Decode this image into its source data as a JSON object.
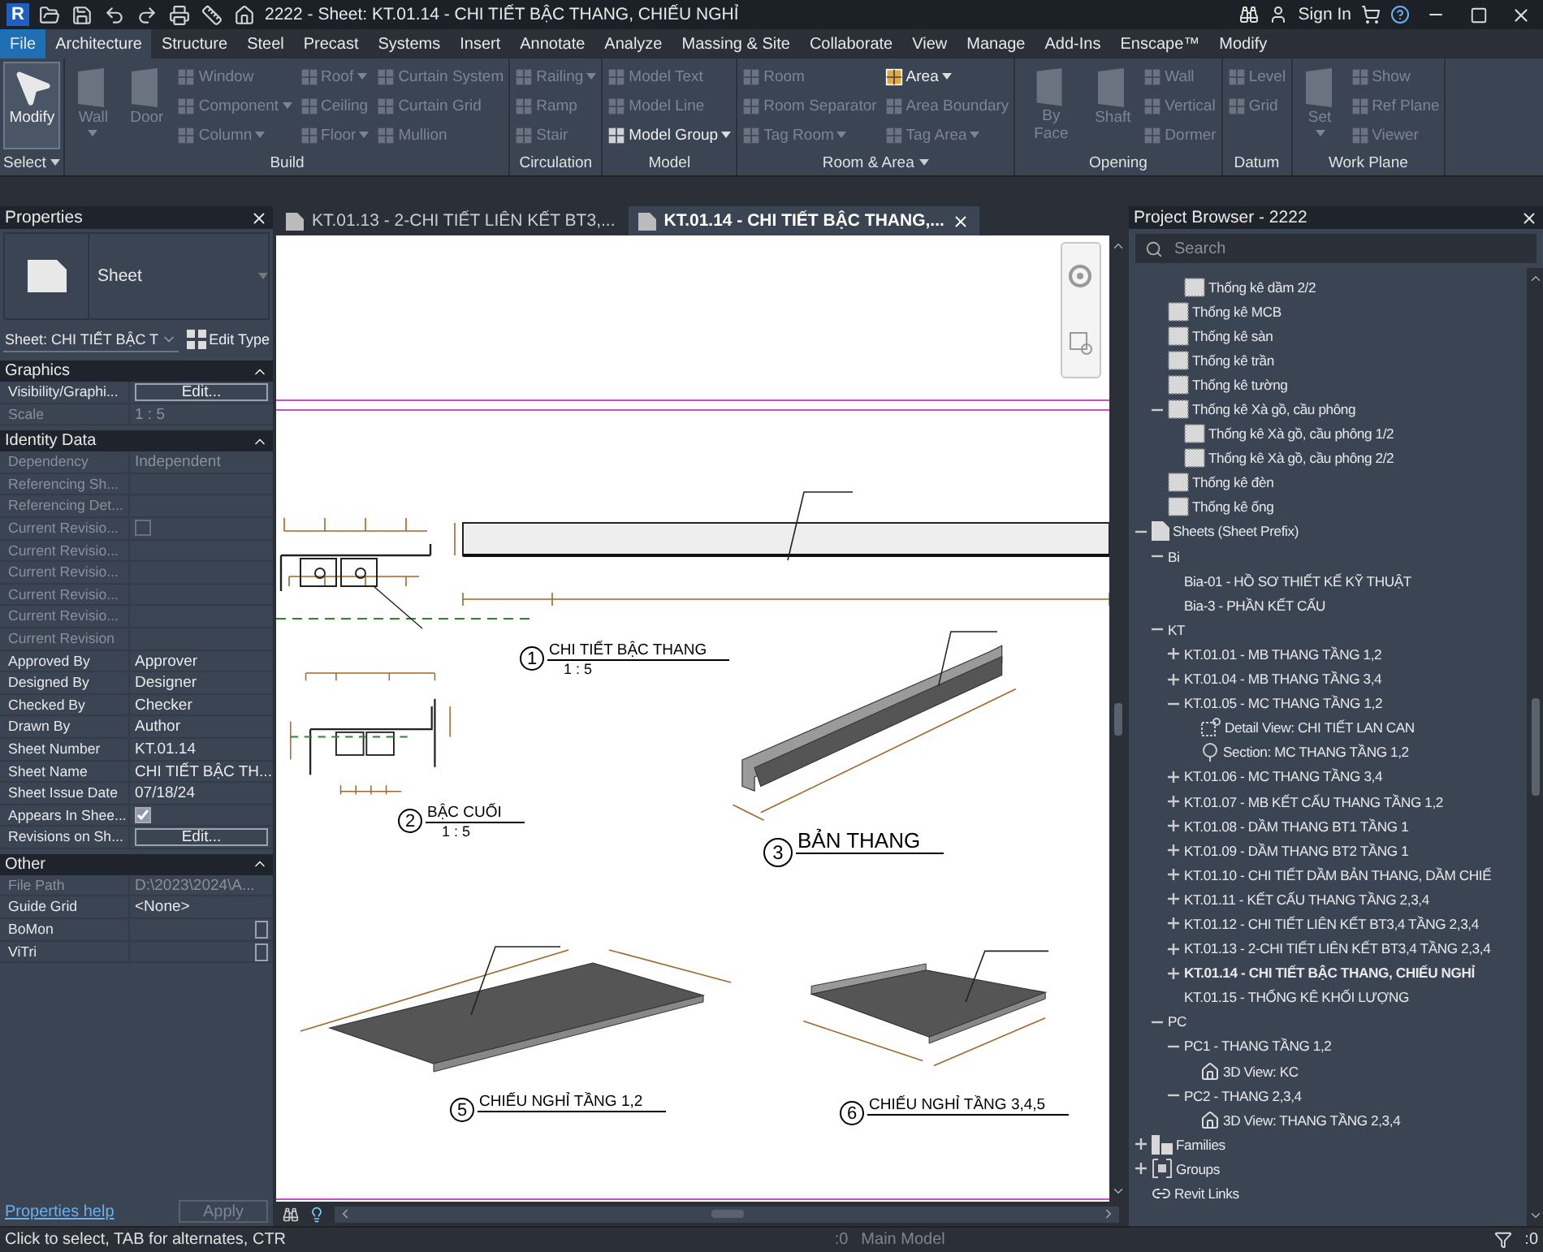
{
  "title_bar": {
    "app_logo": "R",
    "title": "2222 - Sheet: KT.01.14 - CHI TIẾT BẬC THANG, CHIẾU NGHỈ",
    "sign_in": "Sign In"
  },
  "ribbon_tabs": [
    {
      "label": "File",
      "kind": "file",
      "selected": false
    },
    {
      "label": "Architecture",
      "kind": "tab",
      "selected": true
    },
    {
      "label": "Structure",
      "kind": "tab",
      "selected": false
    },
    {
      "label": "Steel",
      "kind": "tab",
      "selected": false
    },
    {
      "label": "Precast",
      "kind": "tab",
      "selected": false
    },
    {
      "label": "Systems",
      "kind": "tab",
      "selected": false
    },
    {
      "label": "Insert",
      "kind": "tab",
      "selected": false
    },
    {
      "label": "Annotate",
      "kind": "tab",
      "selected": false
    },
    {
      "label": "Analyze",
      "kind": "tab",
      "selected": false
    },
    {
      "label": "Massing & Site",
      "kind": "tab",
      "selected": false
    },
    {
      "label": "Collaborate",
      "kind": "tab",
      "selected": false
    },
    {
      "label": "View",
      "kind": "tab",
      "selected": false
    },
    {
      "label": "Manage",
      "kind": "tab",
      "selected": false
    },
    {
      "label": "Add-Ins",
      "kind": "tab",
      "selected": false
    },
    {
      "label": "Enscape™",
      "kind": "tab",
      "selected": false
    },
    {
      "label": "Modify",
      "kind": "tab",
      "selected": false
    }
  ],
  "ribbon_groups": [
    {
      "label": "Select",
      "menu": true,
      "items": [
        {
          "kind": "big",
          "label": "Modify",
          "disabled": false,
          "dropdown": false,
          "active": true
        }
      ]
    },
    {
      "label": "Build",
      "menu": false,
      "items": [
        {
          "kind": "big",
          "label": "Wall",
          "disabled": true,
          "dropdown": true,
          "active": false
        },
        {
          "kind": "big",
          "label": "Door",
          "disabled": true,
          "dropdown": false,
          "active": false
        },
        {
          "kind": "small",
          "label": "Window",
          "disabled": true,
          "dropdown": false,
          "active": false
        },
        {
          "kind": "small",
          "label": "Component",
          "disabled": true,
          "dropdown": true,
          "active": false
        },
        {
          "kind": "small",
          "label": "Column",
          "disabled": true,
          "dropdown": true,
          "active": false
        },
        {
          "kind": "small",
          "label": "Roof",
          "disabled": true,
          "dropdown": true,
          "active": false
        },
        {
          "kind": "small",
          "label": "Ceiling",
          "disabled": true,
          "dropdown": false,
          "active": false
        },
        {
          "kind": "small",
          "label": "Floor",
          "disabled": true,
          "dropdown": true,
          "active": false
        },
        {
          "kind": "small",
          "label": "Curtain System",
          "disabled": true,
          "dropdown": false,
          "active": false
        },
        {
          "kind": "small",
          "label": "Curtain Grid",
          "disabled": true,
          "dropdown": false,
          "active": false
        },
        {
          "kind": "small",
          "label": "Mullion",
          "disabled": true,
          "dropdown": false,
          "active": false
        }
      ]
    },
    {
      "label": "Circulation",
      "menu": false,
      "items": [
        {
          "kind": "small",
          "label": "Railing",
          "disabled": true,
          "dropdown": true,
          "active": false
        },
        {
          "kind": "small",
          "label": "Ramp",
          "disabled": true,
          "dropdown": false,
          "active": false
        },
        {
          "kind": "small",
          "label": "Stair",
          "disabled": true,
          "dropdown": false,
          "active": false
        }
      ]
    },
    {
      "label": "Model",
      "menu": false,
      "items": [
        {
          "kind": "small",
          "label": "Model Text",
          "disabled": true,
          "dropdown": false,
          "active": false
        },
        {
          "kind": "small",
          "label": "Model Line",
          "disabled": true,
          "dropdown": false,
          "active": false
        },
        {
          "kind": "small",
          "label": "Model Group",
          "disabled": false,
          "dropdown": true,
          "active": false
        }
      ]
    },
    {
      "label": "Room & Area",
      "menu": true,
      "items": [
        {
          "kind": "small",
          "label": "Room",
          "disabled": true,
          "dropdown": false,
          "active": false
        },
        {
          "kind": "small",
          "label": "Room Separator",
          "disabled": true,
          "dropdown": false,
          "active": false
        },
        {
          "kind": "small",
          "label": "Tag Room",
          "disabled": true,
          "dropdown": true,
          "active": false
        },
        {
          "kind": "small",
          "label": "Area",
          "disabled": false,
          "dropdown": true,
          "active": false
        },
        {
          "kind": "small",
          "label": "Area Boundary",
          "disabled": true,
          "dropdown": false,
          "active": false
        },
        {
          "kind": "small",
          "label": "Tag Area",
          "disabled": true,
          "dropdown": true,
          "active": false
        }
      ]
    },
    {
      "label": "Opening",
      "menu": false,
      "items": [
        {
          "kind": "big",
          "label": "By Face",
          "disabled": true,
          "dropdown": false,
          "active": false
        },
        {
          "kind": "big",
          "label": "Shaft",
          "disabled": true,
          "dropdown": false,
          "active": false
        },
        {
          "kind": "small",
          "label": "Wall",
          "disabled": true,
          "dropdown": false,
          "active": false
        },
        {
          "kind": "small",
          "label": "Vertical",
          "disabled": true,
          "dropdown": false,
          "active": false
        },
        {
          "kind": "small",
          "label": "Dormer",
          "disabled": true,
          "dropdown": false,
          "active": false
        }
      ]
    },
    {
      "label": "Datum",
      "menu": false,
      "items": [
        {
          "kind": "mid",
          "label": "Level",
          "disabled": true,
          "dropdown": false,
          "active": false
        },
        {
          "kind": "mid",
          "label": "Grid",
          "disabled": true,
          "dropdown": false,
          "active": false
        }
      ]
    },
    {
      "label": "Work Plane",
      "menu": false,
      "items": [
        {
          "kind": "big",
          "label": "Set",
          "disabled": true,
          "dropdown": true,
          "active": false
        },
        {
          "kind": "small",
          "label": "Show",
          "disabled": true,
          "dropdown": false,
          "active": false
        },
        {
          "kind": "small",
          "label": "Ref Plane",
          "disabled": true,
          "dropdown": false,
          "active": false
        },
        {
          "kind": "small",
          "label": "Viewer",
          "disabled": true,
          "dropdown": false,
          "active": false
        }
      ]
    }
  ],
  "properties": {
    "title": "Properties",
    "type_name": "Sheet",
    "instance": "Sheet: CHI TIẾT BẬC T",
    "edit_type": "Edit Type",
    "sections": [
      {
        "title": "Graphics",
        "rows": [
          {
            "label": "Visibility/Graphi...",
            "kind": "button",
            "value": "Edit...",
            "disabled": false
          },
          {
            "label": "Scale",
            "kind": "text",
            "value": "1 : 5",
            "disabled": true
          }
        ]
      },
      {
        "title": "Identity Data",
        "rows": [
          {
            "label": "Dependency",
            "kind": "text",
            "value": "Independent",
            "disabled": true
          },
          {
            "label": "Referencing Sh...",
            "kind": "text",
            "disabled": true
          },
          {
            "label": "Referencing Det...",
            "kind": "text",
            "disabled": true
          },
          {
            "label": "Current Revisio...",
            "kind": "checkbox",
            "checked": false,
            "disabled": true
          },
          {
            "label": "Current Revisio...",
            "kind": "text",
            "disabled": true
          },
          {
            "label": "Current Revisio...",
            "kind": "text",
            "disabled": true
          },
          {
            "label": "Current Revisio...",
            "kind": "text",
            "disabled": true
          },
          {
            "label": "Current Revisio...",
            "kind": "text",
            "disabled": true
          },
          {
            "label": "Current Revision",
            "kind": "text",
            "disabled": true
          },
          {
            "label": "Approved By",
            "kind": "text",
            "value": "Approver",
            "disabled": false
          },
          {
            "label": "Designed By",
            "kind": "text",
            "value": "Designer",
            "disabled": false
          },
          {
            "label": "Checked By",
            "kind": "text",
            "value": "Checker",
            "disabled": false
          },
          {
            "label": "Drawn By",
            "kind": "text",
            "value": "Author",
            "disabled": false
          },
          {
            "label": "Sheet Number",
            "kind": "text",
            "value": "KT.01.14",
            "disabled": false
          },
          {
            "label": "Sheet Name",
            "kind": "text",
            "value": "CHI TIẾT BẬC TH...",
            "disabled": false
          },
          {
            "label": "Sheet Issue Date",
            "kind": "text",
            "value": "07/18/24",
            "disabled": false
          },
          {
            "label": "Appears In Shee...",
            "kind": "checkbox",
            "checked": true,
            "disabled": false
          },
          {
            "label": "Revisions on Sh...",
            "kind": "button",
            "value": "Edit...",
            "disabled": false
          }
        ]
      },
      {
        "title": "Other",
        "rows": [
          {
            "label": "File Path",
            "kind": "text",
            "value": "D:\\2023\\2024\\A...",
            "disabled": true
          },
          {
            "label": "Guide Grid",
            "kind": "text",
            "value": "<None>",
            "disabled": false
          },
          {
            "label": "BoMon",
            "kind": "picker",
            "disabled": false
          },
          {
            "label": "ViTri",
            "kind": "picker",
            "disabled": false
          }
        ]
      }
    ],
    "help": "Properties help",
    "apply": "Apply"
  },
  "view_tabs": [
    {
      "label": "KT.01.13 - 2-CHI TIẾT LIÊN KẾT BT3,...",
      "selected": false
    },
    {
      "label": "KT.01.14 - CHI TIẾT BẬC THANG,...",
      "selected": true
    }
  ],
  "sheet_views": [
    {
      "number": "1",
      "title": "CHI TIẾT BẬC THANG",
      "scale": "1 : 5",
      "kind": "small"
    },
    {
      "number": "2",
      "title": "BẬC CUỐI",
      "scale": "1 : 5",
      "kind": "small"
    },
    {
      "number": "3",
      "title": "BẢN THANG",
      "kind": "large"
    },
    {
      "number": "5",
      "title": "CHIẾU NGHỈ TẦNG 1,2",
      "kind": "small"
    },
    {
      "number": "6",
      "title": "CHIẾU NGHỈ TẦNG 3,4,5",
      "kind": "small"
    }
  ],
  "project_browser": {
    "title": "Project Browser - 2222",
    "search_placeholder": "Search",
    "tree": [
      {
        "children": [
          {
            "children": [
              {
                "label": "Thống kê dầm 2/2",
                "kind": "schedule",
                "selected": false
              }
            ]
          },
          {
            "label": "Thống kê MCB",
            "kind": "schedule",
            "selected": false
          },
          {
            "label": "Thống kê sàn",
            "kind": "schedule",
            "selected": false
          },
          {
            "label": "Thống kê trần",
            "kind": "schedule",
            "selected": false
          },
          {
            "label": "Thống kê tường",
            "kind": "schedule",
            "selected": false
          },
          {
            "label": "Thống kê Xà gồ, cầu phông",
            "kind": "schedule",
            "expanded": true,
            "selected": false,
            "children": [
              {
                "label": "Thống kê Xà gồ, cầu phông 1/2",
                "kind": "schedule",
                "selected": false
              },
              {
                "label": "Thống kê Xà gồ, cầu phông 2/2",
                "kind": "schedule",
                "selected": false
              }
            ]
          },
          {
            "label": "Thống kê đèn",
            "kind": "schedule",
            "selected": false
          },
          {
            "label": "Thống kê ống",
            "kind": "schedule",
            "selected": false
          }
        ]
      },
      {
        "label": "Sheets (Sheet Prefix)",
        "kind": "sheets",
        "expanded": true,
        "selected": false,
        "children": [
          {
            "label": "Bi",
            "expanded": true,
            "selected": false,
            "children": [
              {
                "label": "Bia-01 - HỒ SƠ THIẾT KẾ KỸ THUẬT",
                "selected": false
              },
              {
                "label": "Bia-3 - PHẦN KẾT CẤU",
                "selected": false
              }
            ]
          },
          {
            "label": "KT",
            "expanded": true,
            "selected": false,
            "children": [
              {
                "label": "KT.01.01 - MB THANG TẦNG 1,2",
                "expanded": false,
                "selected": false
              },
              {
                "label": "KT.01.04 - MB THANG TẦNG 3,4",
                "expanded": false,
                "selected": false
              },
              {
                "label": "KT.01.05 - MC THANG TẦNG 1,2",
                "expanded": true,
                "selected": false,
                "children": [
                  {
                    "label": "Detail View: CHI TIẾT LAN CAN",
                    "kind": "detail",
                    "selected": false
                  },
                  {
                    "label": "Section: MC THANG TẦNG 1,2",
                    "kind": "section",
                    "selected": false
                  }
                ]
              },
              {
                "label": "KT.01.06 - MC THANG TẦNG 3,4",
                "expanded": false,
                "selected": false
              },
              {
                "label": "KT.01.07 - MB KẾT CẤU THANG TẦNG 1,2",
                "expanded": false,
                "selected": false
              },
              {
                "label": "KT.01.08 - DẦM THANG BT1 TẦNG 1",
                "expanded": false,
                "selected": false
              },
              {
                "label": "KT.01.09 - DẦM THANG BT2 TẦNG 1",
                "expanded": false,
                "selected": false
              },
              {
                "label": "KT.01.10 - CHI TIẾT DẦM BẢN THANG, DẦM CHIẾ",
                "expanded": false,
                "selected": false
              },
              {
                "label": "KT.01.11 - KẾT CẤU THANG TẦNG 2,3,4",
                "expanded": false,
                "selected": false
              },
              {
                "label": "KT.01.12 - CHI TIẾT LIÊN KẾT BT3,4 TẦNG 2,3,4",
                "expanded": false,
                "selected": false
              },
              {
                "label": "KT.01.13 - 2-CHI TIẾT LIÊN KẾT BT3,4 TẦNG 2,3,4",
                "expanded": false,
                "selected": false
              },
              {
                "label": "KT.01.14 - CHI TIẾT BẬC THANG, CHIẾU NGHỈ",
                "expanded": false,
                "selected": true
              },
              {
                "label": "KT.01.15 - THỐNG KÊ KHỐI LƯỢNG",
                "selected": false
              }
            ]
          },
          {
            "label": "PC",
            "expanded": true,
            "selected": false,
            "children": [
              {
                "label": "PC1 - THANG TẦNG 1,2",
                "expanded": true,
                "selected": false,
                "children": [
                  {
                    "label": "3D View: KC",
                    "kind": "view3d",
                    "selected": false
                  }
                ]
              },
              {
                "label": "PC2 - THANG 2,3,4",
                "expanded": true,
                "selected": false,
                "children": [
                  {
                    "label": "3D View: THANG TẦNG 2,3,4",
                    "kind": "view3d",
                    "selected": false
                  }
                ]
              }
            ]
          }
        ]
      },
      {
        "label": "Families",
        "kind": "families",
        "expanded": false,
        "selected": false
      },
      {
        "label": "Groups",
        "kind": "groups",
        "expanded": false,
        "selected": false
      },
      {
        "label": "Revit Links",
        "kind": "links",
        "selected": false
      }
    ]
  },
  "status_bar": {
    "hint": "Click to select, TAB for alternates, CTR",
    "workset_count": ":0",
    "design_option": "Main Model",
    "selection_count": ":0"
  }
}
